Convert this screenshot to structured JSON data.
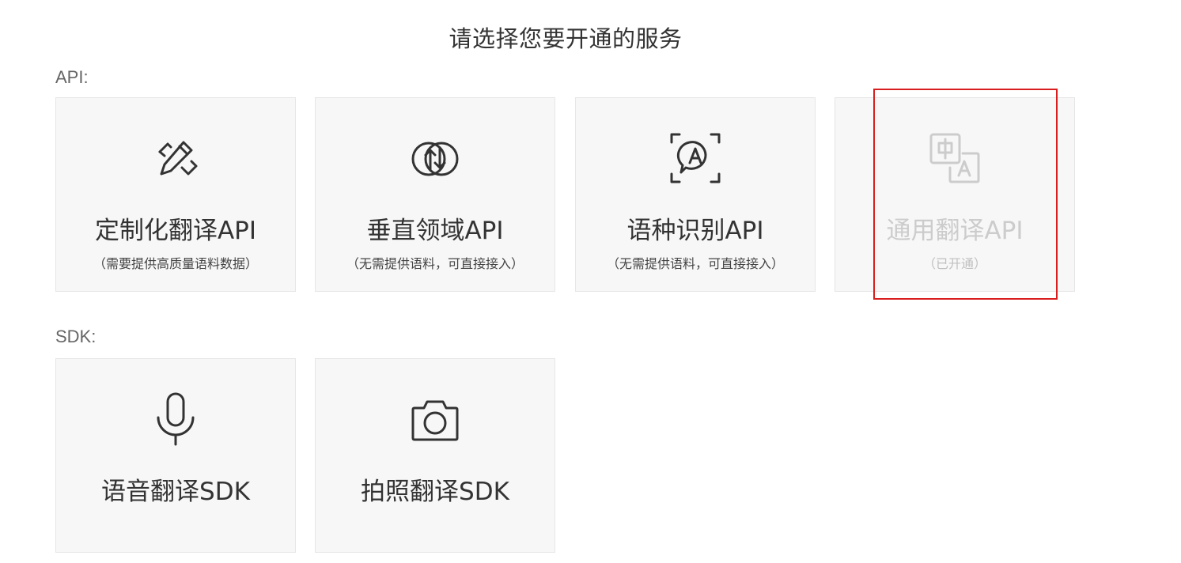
{
  "header": {
    "title": "请选择您要开通的服务"
  },
  "sections": {
    "api": {
      "label": "API:",
      "cards": [
        {
          "title": "定制化翻译API",
          "subtitle": "（需要提供高质量语料数据）",
          "icon": "pencil-ruler-icon",
          "enabled": true
        },
        {
          "title": "垂直领域API",
          "subtitle": "（无需提供语料，可直接接入）",
          "icon": "sync-arrows-icon",
          "enabled": true
        },
        {
          "title": "语种识别API",
          "subtitle": "（无需提供语料，可直接接入）",
          "icon": "language-detect-icon",
          "enabled": true
        },
        {
          "title": "通用翻译API",
          "subtitle": "（已开通）",
          "icon": "translate-icon",
          "enabled": false
        }
      ]
    },
    "sdk": {
      "label": "SDK:",
      "cards": [
        {
          "title": "语音翻译SDK",
          "icon": "microphone-icon",
          "enabled": true
        },
        {
          "title": "拍照翻译SDK",
          "icon": "camera-icon",
          "enabled": true
        }
      ]
    }
  },
  "colors": {
    "card_bg": "#f7f7f7",
    "card_border": "#e6e6e6",
    "text": "#333333",
    "disabled_text": "#cccccc",
    "highlight": "#d81e1e"
  }
}
